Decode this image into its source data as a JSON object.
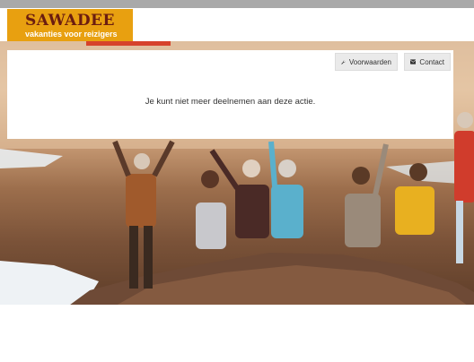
{
  "brand": {
    "name": "SAWADEE",
    "tagline": "vakanties voor reizigers"
  },
  "nav": {
    "voorwaarden_label": "Voorwaarden",
    "contact_label": "Contact"
  },
  "message": "Je kunt niet meer deelnemen aan deze actie."
}
